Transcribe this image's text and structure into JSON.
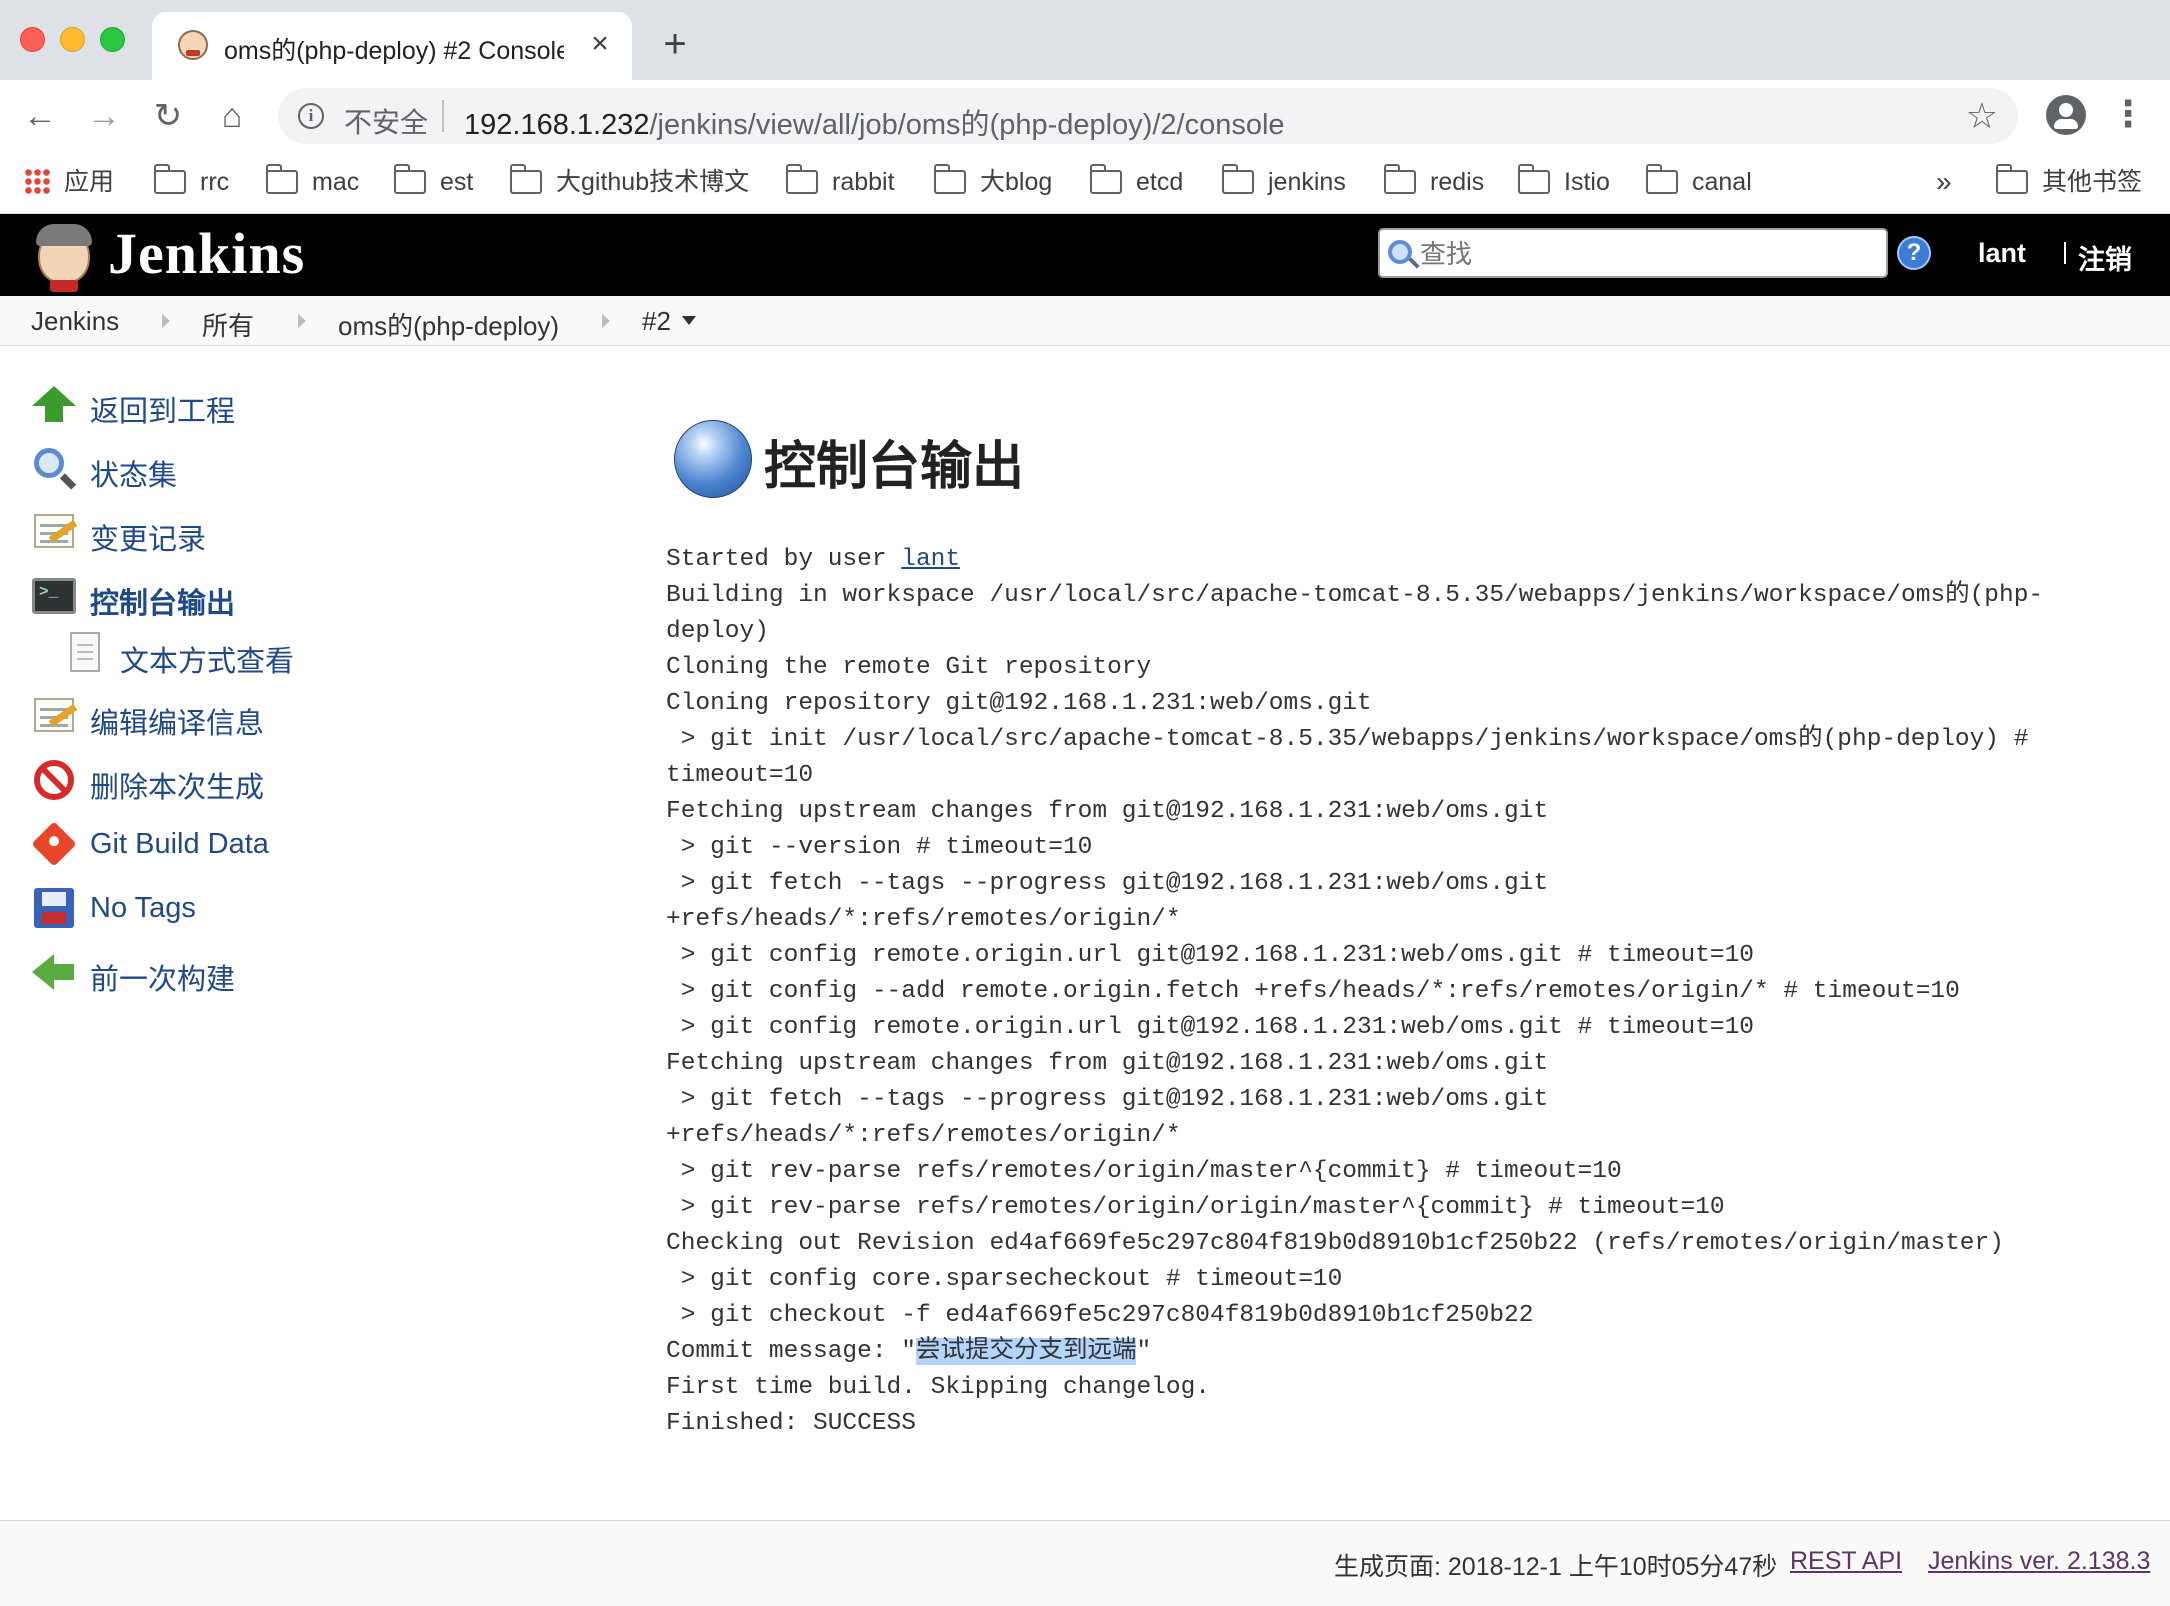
{
  "browser": {
    "tab_title": "oms的(php-deploy) #2 Console",
    "tab_close": "×",
    "new_tab": "+",
    "insecure_label": "不安全",
    "url_host": "192.168.1.232",
    "url_path": "/jenkins/view/all/job/oms的(php-deploy)/2/console",
    "nav": {
      "back": "←",
      "forward": "→",
      "reload": "↻",
      "home": "⌂"
    },
    "star": "☆",
    "menu": "⋮",
    "bookmarks": [
      {
        "label": "应用",
        "icon": "apps-grid-icon"
      },
      {
        "label": "rrc",
        "icon": "folder-icon"
      },
      {
        "label": "mac",
        "icon": "folder-icon"
      },
      {
        "label": "est",
        "icon": "folder-icon"
      },
      {
        "label": "大github技术博文",
        "icon": "folder-icon"
      },
      {
        "label": "rabbit",
        "icon": "folder-icon"
      },
      {
        "label": "大blog",
        "icon": "folder-icon"
      },
      {
        "label": "etcd",
        "icon": "folder-icon"
      },
      {
        "label": "jenkins",
        "icon": "folder-icon"
      },
      {
        "label": "redis",
        "icon": "folder-icon"
      },
      {
        "label": "Istio",
        "icon": "folder-icon"
      },
      {
        "label": "canal",
        "icon": "folder-icon"
      }
    ],
    "bookmarks_more": "»",
    "other_bookmarks": "其他书签"
  },
  "jenkins": {
    "title": "Jenkins",
    "search_placeholder": "查找",
    "help": "?",
    "user": "lant",
    "logout": "注销"
  },
  "breadcrumb": [
    "Jenkins",
    "所有",
    "oms的(php-deploy)",
    "#2"
  ],
  "sidebar": [
    {
      "label": "返回到工程",
      "icon": "up-arrow-icon"
    },
    {
      "label": "状态集",
      "icon": "magnifier-icon"
    },
    {
      "label": "变更记录",
      "icon": "notepad-icon"
    },
    {
      "label": "控制台输出",
      "icon": "terminal-icon",
      "active": true
    },
    {
      "label": "文本方式查看",
      "icon": "document-icon"
    },
    {
      "label": "编辑编译信息",
      "icon": "notepad-icon"
    },
    {
      "label": "删除本次生成",
      "icon": "no-entry-icon"
    },
    {
      "label": "Git Build Data",
      "icon": "git-icon"
    },
    {
      "label": "No Tags",
      "icon": "floppy-disk-icon"
    },
    {
      "label": "前一次构建",
      "icon": "left-arrow-icon"
    }
  ],
  "main": {
    "heading": "控制台输出",
    "started_prefix": "Started by user ",
    "started_user": "lant",
    "lines": [
      "Building in workspace /usr/local/src/apache-tomcat-8.5.35/webapps/jenkins/workspace/oms的(php-",
      "deploy)",
      "Cloning the remote Git repository",
      "Cloning repository git@192.168.1.231:web/oms.git",
      " > git init /usr/local/src/apache-tomcat-8.5.35/webapps/jenkins/workspace/oms的(php-deploy) #",
      "timeout=10",
      "Fetching upstream changes from git@192.168.1.231:web/oms.git",
      " > git --version # timeout=10",
      " > git fetch --tags --progress git@192.168.1.231:web/oms.git",
      "+refs/heads/*:refs/remotes/origin/*",
      " > git config remote.origin.url git@192.168.1.231:web/oms.git # timeout=10",
      " > git config --add remote.origin.fetch +refs/heads/*:refs/remotes/origin/* # timeout=10",
      " > git config remote.origin.url git@192.168.1.231:web/oms.git # timeout=10",
      "Fetching upstream changes from git@192.168.1.231:web/oms.git",
      " > git fetch --tags --progress git@192.168.1.231:web/oms.git",
      "+refs/heads/*:refs/remotes/origin/*",
      " > git rev-parse refs/remotes/origin/master^{commit} # timeout=10",
      " > git rev-parse refs/remotes/origin/origin/master^{commit} # timeout=10",
      "Checking out Revision ed4af669fe5c297c804f819b0d8910b1cf250b22 (refs/remotes/origin/master)",
      " > git config core.sparsecheckout # timeout=10",
      " > git checkout -f ed4af669fe5c297c804f819b0d8910b1cf250b22"
    ],
    "commit_prefix": "Commit message: \"",
    "commit_message": "尝试提交分支到远端",
    "commit_suffix": "\"",
    "tail_lines": [
      "First time build. Skipping changelog.",
      "Finished: SUCCESS"
    ]
  },
  "footer": {
    "generated": "生成页面: 2018-12-1 上午10时05分47秒",
    "rest_api": "REST API",
    "version": "Jenkins ver. 2.138.3"
  }
}
